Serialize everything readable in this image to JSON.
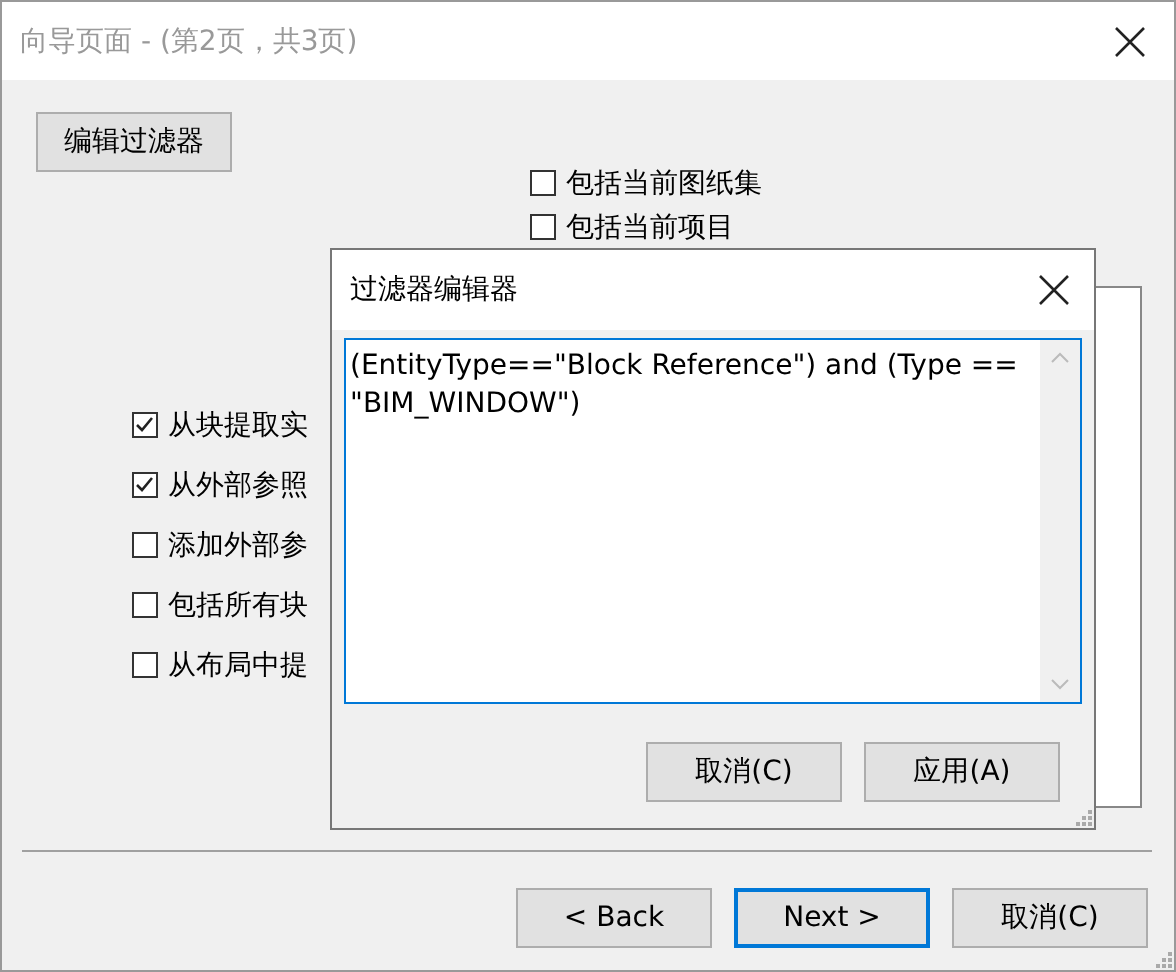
{
  "window": {
    "title": "向导页面 - (第2页，共3页)"
  },
  "edit_filter_button": "编辑过滤器",
  "top_options": [
    {
      "label": "包括当前图纸集",
      "checked": false
    },
    {
      "label": "包括当前项目",
      "checked": false
    }
  ],
  "options": [
    {
      "label": "从块提取实",
      "checked": true
    },
    {
      "label": "从外部参照",
      "checked": true
    },
    {
      "label": "添加外部参",
      "checked": false
    },
    {
      "label": "包括所有块",
      "checked": false
    },
    {
      "label": "从布局中提",
      "checked": false
    }
  ],
  "footer_buttons": [
    {
      "label": "< Back",
      "default": false
    },
    {
      "label": "Next >",
      "default": true
    },
    {
      "label": "取消(C)",
      "default": false
    }
  ],
  "dialog": {
    "title": "过滤器编辑器",
    "expression": "(EntityType==\"Block Reference\") and (Type == \"BIM_WINDOW\")",
    "buttons": [
      "取消(C)",
      "应用(A)"
    ]
  }
}
